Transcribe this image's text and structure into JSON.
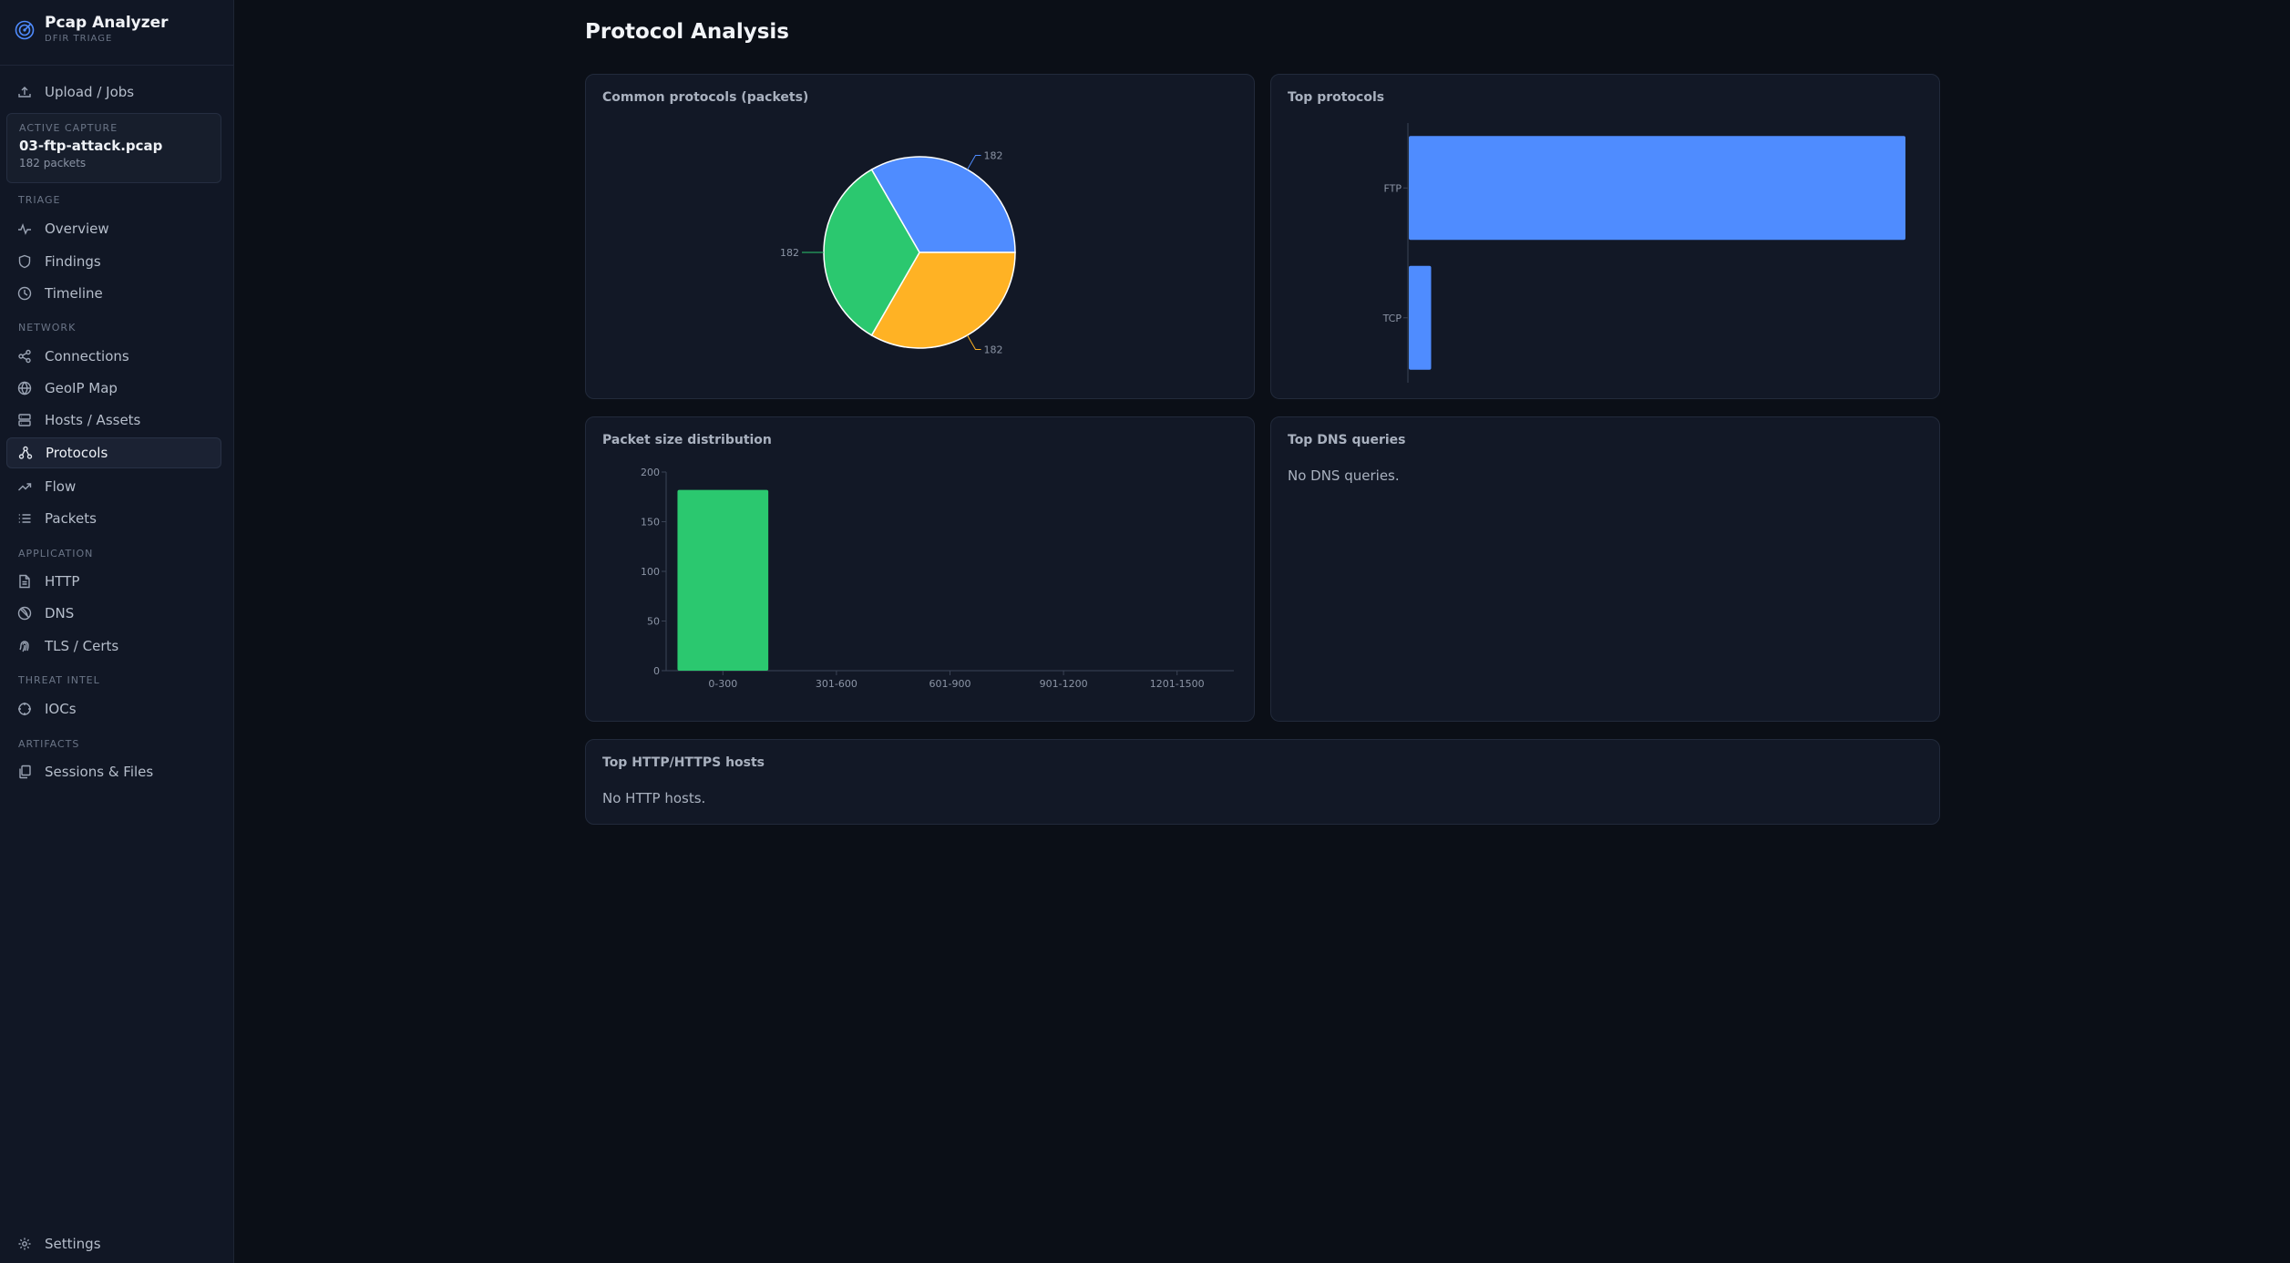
{
  "app": {
    "title": "Pcap Analyzer",
    "subtitle": "DFIR TRIAGE"
  },
  "nav": {
    "upload": "Upload / Jobs",
    "capture": {
      "label": "ACTIVE CAPTURE",
      "name": "03-ftp-attack.pcap",
      "packets": "182 packets"
    },
    "sections": {
      "triage": "TRIAGE",
      "network": "NETWORK",
      "application": "APPLICATION",
      "threat_intel": "THREAT INTEL",
      "artifacts": "ARTIFACTS"
    },
    "items": {
      "overview": "Overview",
      "findings": "Findings",
      "timeline": "Timeline",
      "connections": "Connections",
      "geoip": "GeoIP Map",
      "hosts": "Hosts / Assets",
      "protocols": "Protocols",
      "flow": "Flow",
      "packets": "Packets",
      "http": "HTTP",
      "dns": "DNS",
      "tls": "TLS / Certs",
      "iocs": "IOCs",
      "sessions": "Sessions & Files",
      "settings": "Settings"
    }
  },
  "page": {
    "title": "Protocol Analysis"
  },
  "cards": {
    "common_protocols": "Common protocols (packets)",
    "top_protocols": "Top protocols",
    "packet_size": "Packet size distribution",
    "top_dns": "Top DNS queries",
    "top_dns_empty": "No DNS queries.",
    "top_http": "Top HTTP/HTTPS hosts",
    "top_http_empty": "No HTTP hosts."
  },
  "colors": {
    "blue": "#4f8cff",
    "green": "#2bc86f",
    "orange": "#ffb224",
    "accent": "#4f8cff"
  },
  "chart_data": [
    {
      "type": "pie",
      "title": "Common protocols (packets)",
      "slices": [
        {
          "value": 182,
          "label": "182",
          "color": "#4f8cff"
        },
        {
          "value": 182,
          "label": "182",
          "color": "#ffb224"
        },
        {
          "value": 182,
          "label": "182",
          "color": "#2bc86f"
        }
      ]
    },
    {
      "type": "bar",
      "orientation": "horizontal",
      "title": "Top protocols",
      "categories": [
        "FTP",
        "TCP"
      ],
      "values": [
        182,
        8.5
      ],
      "color": "#4f8cff"
    },
    {
      "type": "bar",
      "title": "Packet size distribution",
      "categories": [
        "0-300",
        "301-600",
        "601-900",
        "901-1200",
        "1201-1500"
      ],
      "values": [
        182,
        0,
        0,
        0,
        0
      ],
      "yticks": [
        "0",
        "50",
        "100",
        "150",
        "200"
      ],
      "ylim": [
        0,
        200
      ],
      "color": "#2bc86f"
    }
  ]
}
